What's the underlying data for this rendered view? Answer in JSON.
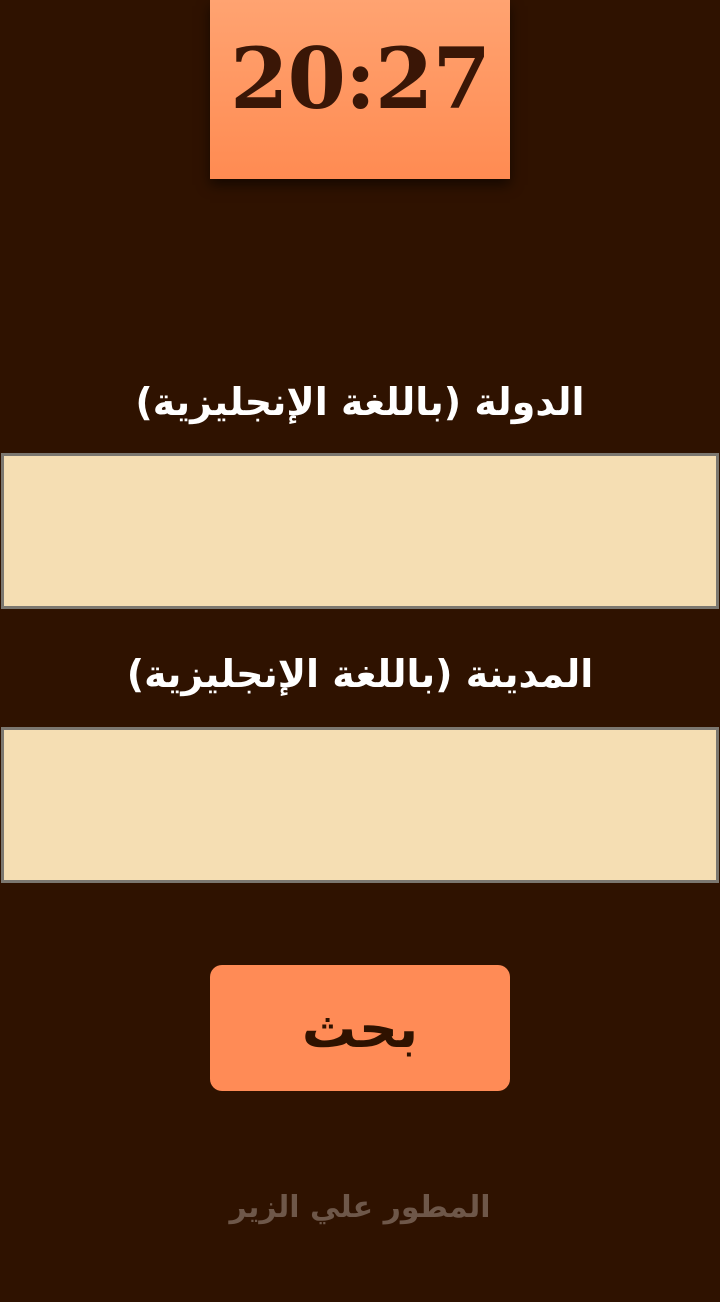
{
  "clock": {
    "time": "20:27"
  },
  "form": {
    "country_label": "الدولة (باللغة الإنجليزية)",
    "country_value": "",
    "city_label": "المدينة (باللغة الإنجليزية)",
    "city_value": "",
    "search_button_label": "بحث"
  },
  "footer": {
    "developer_credit": "المطور علي الزير"
  },
  "colors": {
    "background": "#2f1200",
    "accent": "#ff8b56",
    "field_background": "#f5deb3",
    "label_text": "#ffffff",
    "credit_text": "#6e5749"
  }
}
